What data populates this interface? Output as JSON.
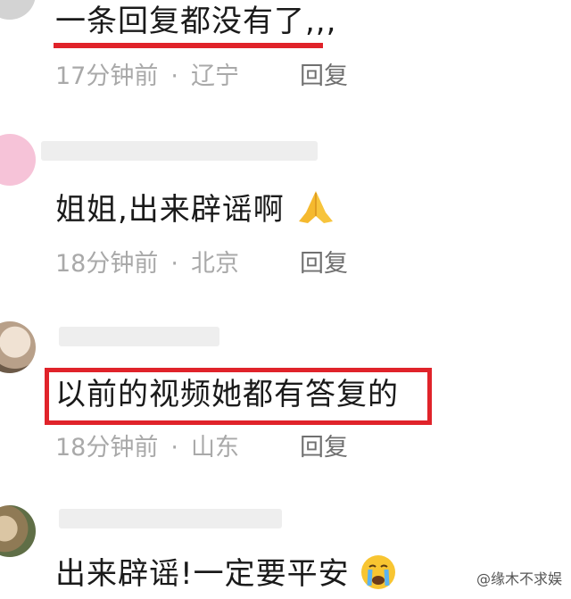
{
  "comments": [
    {
      "text": "一条回复都没有了,,,",
      "time": "17分钟前",
      "location": "辽宁",
      "reply": "回复"
    },
    {
      "text": "姐姐,出来辟谣啊",
      "emoji": "pray-emoji",
      "time": "18分钟前",
      "location": "北京",
      "reply": "回复"
    },
    {
      "text": "以前的视频她都有答复的",
      "time": "18分钟前",
      "location": "山东",
      "reply": "回复"
    },
    {
      "text": "出来辟谣!一定要平安",
      "emoji": "crying-face-emoji"
    }
  ],
  "separator": "·",
  "watermark": "@缘木不求娱",
  "colors": {
    "highlight": "#e0232a",
    "meta": "#a9a9a9",
    "reply": "#707070"
  }
}
